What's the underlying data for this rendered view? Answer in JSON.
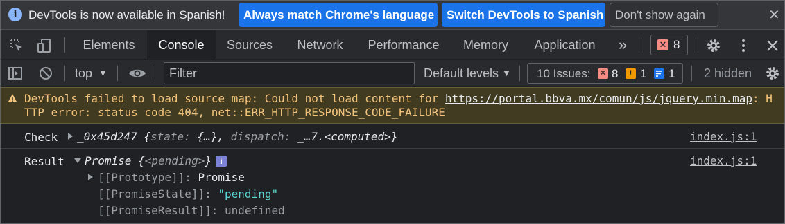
{
  "infobar": {
    "message": "DevTools is now available in Spanish!",
    "btn_match": "Always match Chrome's language",
    "btn_switch": "Switch DevTools to Spanish",
    "btn_dismiss": "Don't show again",
    "close_glyph": "✕"
  },
  "tabs": {
    "items": [
      "Elements",
      "Console",
      "Sources",
      "Network",
      "Performance",
      "Memory",
      "Application"
    ],
    "active": "Console",
    "more_glyph": "»",
    "error_count": "8"
  },
  "console_toolbar": {
    "context": "top",
    "filter_placeholder": "Filter",
    "levels": "Default levels",
    "issues_label": "10 Issues:",
    "issues_errors": "8",
    "issues_warnings": "1",
    "issues_info": "1",
    "hidden": "2 hidden"
  },
  "messages": {
    "warning": {
      "prefix": "DevTools failed to load source map: Could not load content for ",
      "url": "https://portal.bbva.mx/comun/js/jquery.min.map",
      "suffix": ": HTTP error: status code 404, net::ERR_HTTP_RESPONSE_CODE_FAILURE"
    },
    "check": {
      "label": "Check",
      "name": "_0x45d247",
      "brace_open": "{",
      "k1": "state",
      "v1": "{…}",
      "k2": "dispatch",
      "v2": "_…7.<computed>",
      "brace_close": "}",
      "source": "index.js:1"
    },
    "result": {
      "label": "Result",
      "type": "Promise",
      "state_preview": "<pending>",
      "source": "index.js:1",
      "prototype_key": "[[Prototype]]",
      "prototype_val": "Promise",
      "state_key": "[[PromiseState]]",
      "state_val": "\"pending\"",
      "result_key": "[[PromiseResult]]",
      "result_val": "undefined"
    }
  },
  "colors": {
    "accent": "#1a73e8",
    "error": "#f28b82",
    "warning": "#f2c37b",
    "info": "#8ab4f8",
    "string": "#5cd5d4"
  }
}
